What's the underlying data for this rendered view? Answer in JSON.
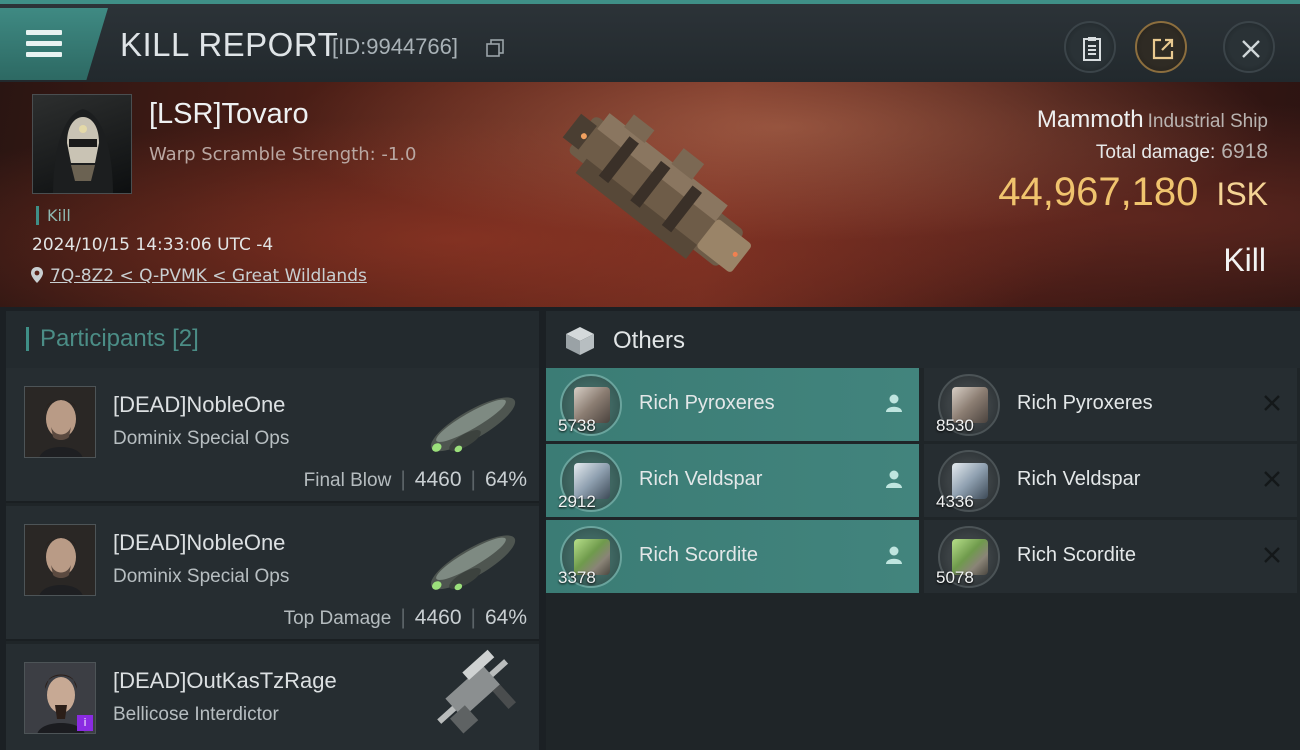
{
  "header": {
    "title": "KILL REPORT",
    "report_id": "[ID:9944766]",
    "icons": [
      "menu-icon",
      "copy-icon",
      "clipboard-icon",
      "share-icon",
      "close-icon"
    ]
  },
  "victim": {
    "name": "[LSR]Tovaro",
    "attribute": "Warp Scramble Strength: -1.0",
    "tag": "Kill",
    "timestamp": "2024/10/15 14:33:06 UTC -4",
    "location": "7Q-8Z2 < Q-PVMK < Great Wildlands",
    "ship_name": "Mammoth",
    "ship_class": "Industrial Ship",
    "total_damage_label": "Total damage:",
    "total_damage": "6918",
    "isk_value": "44,967,180",
    "isk_unit": "ISK",
    "result": "Kill"
  },
  "participants": {
    "title": "Participants",
    "count": "[2]",
    "rows": [
      {
        "name": "[DEAD]NobleOne",
        "ship": "Dominix Special Ops",
        "label": "Final Blow",
        "damage": "4460",
        "percent": "64%"
      },
      {
        "name": "[DEAD]NobleOne",
        "ship": "Dominix Special Ops",
        "label": "Top Damage",
        "damage": "4460",
        "percent": "64%"
      },
      {
        "name": "[DEAD]OutKasTzRage",
        "ship": "Bellicose Interdictor"
      }
    ]
  },
  "others": {
    "title": "Others",
    "items": [
      {
        "name": "Rich Pyroxeres",
        "qty": "5738",
        "status": "looted"
      },
      {
        "name": "Rich Pyroxeres",
        "qty": "8530",
        "status": "destroyed"
      },
      {
        "name": "Rich Veldspar",
        "qty": "2912",
        "status": "looted"
      },
      {
        "name": "Rich Veldspar",
        "qty": "4336",
        "status": "destroyed"
      },
      {
        "name": "Rich Scordite",
        "qty": "3378",
        "status": "looted"
      },
      {
        "name": "Rich Scordite",
        "qty": "5078",
        "status": "destroyed"
      }
    ]
  },
  "colors": {
    "accent": "#3f8f87",
    "isk": "#f0c46e",
    "loot_row": "#3f807a"
  }
}
